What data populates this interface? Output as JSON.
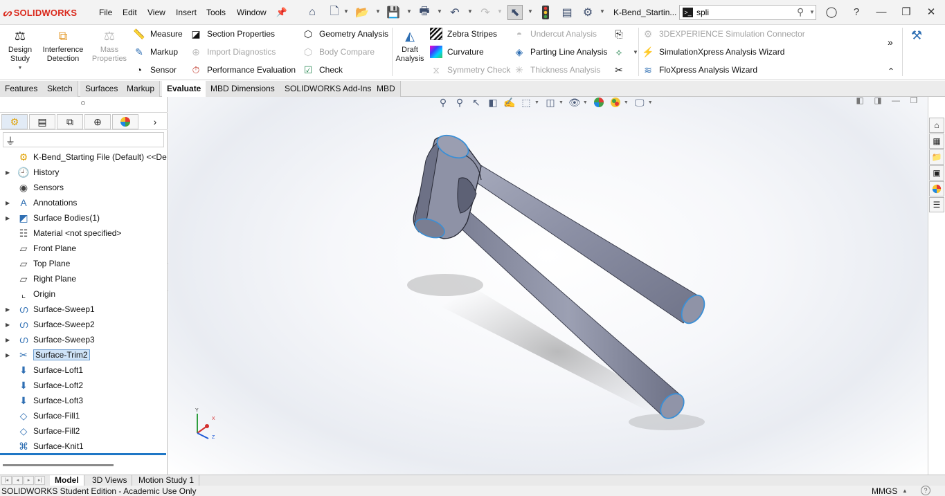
{
  "app": {
    "logo_text": "SOLIDWORKS",
    "document_title": "K-Bend_Startin..."
  },
  "menu": [
    "File",
    "Edit",
    "View",
    "Insert",
    "Tools",
    "Window"
  ],
  "search": {
    "value": "spli",
    "placeholder": ""
  },
  "ribbon": {
    "design_study": "Design Study",
    "interference": "Interference Detection",
    "mass_properties": "Mass Properties",
    "measure": "Measure",
    "markup": "Markup",
    "sensor": "Sensor",
    "section_properties": "Section Properties",
    "import_diagnostics": "Import Diagnostics",
    "performance_evaluation": "Performance Evaluation",
    "geometry_analysis": "Geometry Analysis",
    "body_compare": "Body Compare",
    "check": "Check",
    "draft_analysis": "Draft Analysis",
    "zebra_stripes": "Zebra Stripes",
    "curvature": "Curvature",
    "symmetry_check": "Symmetry Check",
    "undercut_analysis": "Undercut Analysis",
    "parting_line_analysis": "Parting Line Analysis",
    "thickness_analysis": "Thickness Analysis",
    "sim_connector": "3DEXPERIENCE Simulation Connector",
    "simxpress": "SimulationXpress Analysis Wizard",
    "floxpress": "FloXpress Analysis Wizard"
  },
  "command_tabs": [
    {
      "label": "Features"
    },
    {
      "label": "Sketch"
    },
    {
      "label": "Surfaces"
    },
    {
      "label": "Markup"
    },
    {
      "label": "Evaluate"
    },
    {
      "label": "MBD Dimensions"
    },
    {
      "label": "SOLIDWORKS Add-Ins"
    },
    {
      "label": "MBD"
    }
  ],
  "active_command_tab": "Evaluate",
  "tree": [
    {
      "label": "K-Bend_Starting File (Default) <<De",
      "icon": "part-icon",
      "expandable": false
    },
    {
      "label": "History",
      "icon": "history-icon",
      "expandable": true
    },
    {
      "label": "Sensors",
      "icon": "sensors-icon",
      "expandable": false
    },
    {
      "label": "Annotations",
      "icon": "annotations-icon",
      "expandable": true
    },
    {
      "label": "Surface Bodies(1)",
      "icon": "surface-bodies-icon",
      "expandable": true
    },
    {
      "label": "Material <not specified>",
      "icon": "material-icon",
      "expandable": false
    },
    {
      "label": "Front Plane",
      "icon": "plane-icon",
      "expandable": false
    },
    {
      "label": "Top Plane",
      "icon": "plane-icon",
      "expandable": false
    },
    {
      "label": "Right Plane",
      "icon": "plane-icon",
      "expandable": false
    },
    {
      "label": "Origin",
      "icon": "origin-icon",
      "expandable": false
    },
    {
      "label": "Surface-Sweep1",
      "icon": "surface-sweep-icon",
      "expandable": true
    },
    {
      "label": "Surface-Sweep2",
      "icon": "surface-sweep-icon",
      "expandable": true
    },
    {
      "label": "Surface-Sweep3",
      "icon": "surface-sweep-icon",
      "expandable": true
    },
    {
      "label": "Surface-Trim2",
      "icon": "surface-trim-icon",
      "expandable": true,
      "selected": true
    },
    {
      "label": "Surface-Loft1",
      "icon": "surface-loft-icon",
      "expandable": false
    },
    {
      "label": "Surface-Loft2",
      "icon": "surface-loft-icon",
      "expandable": false
    },
    {
      "label": "Surface-Loft3",
      "icon": "surface-loft-icon",
      "expandable": false
    },
    {
      "label": "Surface-Fill1",
      "icon": "surface-fill-icon",
      "expandable": false
    },
    {
      "label": "Surface-Fill2",
      "icon": "surface-fill-icon",
      "expandable": false
    },
    {
      "label": "Surface-Knit1",
      "icon": "surface-knit-icon",
      "expandable": false
    }
  ],
  "triad": {
    "x": "X",
    "y": "Y",
    "z": "Z"
  },
  "bottom_tabs": [
    {
      "label": "Model"
    },
    {
      "label": "3D Views"
    },
    {
      "label": "Motion Study 1"
    }
  ],
  "status": {
    "edition": "SOLIDWORKS Student Edition - Academic Use Only",
    "units": "MMGS"
  },
  "colors": {
    "brand": "#da291c",
    "model_surface": "#8e93a8",
    "edge_highlight": "#3a8fd6",
    "selection": "#cfe3f7"
  }
}
